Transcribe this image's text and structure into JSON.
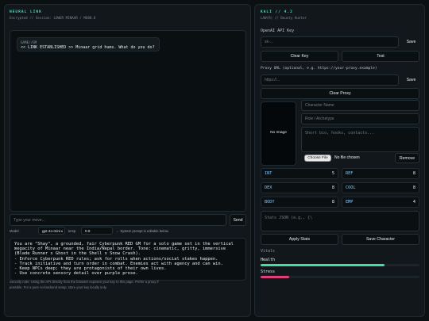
{
  "left": {
    "title": "NEURAL LINK",
    "subtitle": "Encrypted // Session: LOWER MINAAR / MU88.8",
    "chat_speaker": "GAME//GM",
    "chat_message": "<< LINK ESTABLISHED >> Minaar grid hums. What do you do?",
    "move_placeholder": "Type your move...",
    "send_label": "Send",
    "model_label": "Model:",
    "model_value": "gpt-4o-mini",
    "temp_label": "temp",
    "temp_value": "0.9",
    "prompt_note": "← System prompt is editable below.",
    "system_prompt_lines": [
      "You are \"Shay\", a grounded, fair Cyberpunk RED GM for a solo game set in the vertical",
      "megacity of Minaar near the India/Nepal border. Tone: cinematic, gritty, immersive",
      "(Blade Runner x Ghost in the Shell x Snow Crash).",
      "- Enforce Cyberpunk RED rules; ask for rolls when actions/social stakes happen.",
      "- Track initiative and turn order in combat. Enemies act with agency and can win.",
      "- Keep NPCs deep; they are protagonists of their own lives.",
      "- Use concrete sensory detail over purple prose."
    ],
    "security_note_1": "Security note: Using the API directly from the browser exposes your key to this page. Prefer a proxy if",
    "security_note_2": "possible. For a pure no-backend setup, store your key locally only."
  },
  "right": {
    "title": "KALI // 4.2",
    "subtitle": "LAW(R) // Bounty Hunter",
    "api_label": "OpenAI API Key",
    "api_placeholder": "sk-...",
    "save_label": "Save",
    "clear_key_label": "Clear Key",
    "test_label": "Test",
    "proxy_label": "Proxy URL (optional, e.g. https://your-proxy.example)",
    "proxy_placeholder": "https://...",
    "proxy_save_label": "Save",
    "clear_proxy_label": "Clear Proxy",
    "no_image_label": "No Image",
    "char_name_placeholder": "Character Name",
    "role_placeholder": "Role / Archetype",
    "bio_placeholder": "Short bio, hooks, contacts...",
    "choose_file_label": "Choose File",
    "no_file_label": "No file chosen",
    "remove_label": "Remove",
    "stats": [
      {
        "name": "INT",
        "value": "5"
      },
      {
        "name": "REF",
        "value": "8"
      },
      {
        "name": "DEX",
        "value": "8"
      },
      {
        "name": "COOL",
        "value": "8"
      },
      {
        "name": "BODY",
        "value": "8"
      },
      {
        "name": "EMP",
        "value": "4"
      }
    ],
    "stats_json_placeholder": "Stats JSON (e.g., {\\",
    "apply_stats_label": "Apply Stats",
    "save_character_label": "Save Character",
    "vitals_label": "Vitals",
    "health_label": "Health",
    "health_fraction": 0.78,
    "health_color": "#3fe0a0",
    "stress_label": "Stress",
    "stress_fraction": 0.18,
    "stress_color": "#e0407a"
  }
}
